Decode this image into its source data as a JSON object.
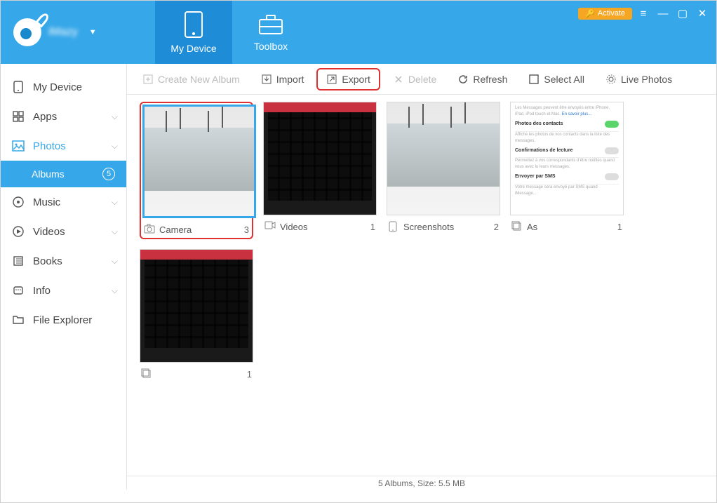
{
  "header": {
    "tabs": [
      {
        "label": "My Device",
        "active": true
      },
      {
        "label": "Toolbox",
        "active": false
      }
    ],
    "activate_label": "Activate"
  },
  "sidebar": {
    "items": [
      {
        "icon": "device",
        "label": "My Device",
        "expandable": false
      },
      {
        "icon": "apps",
        "label": "Apps",
        "expandable": true
      },
      {
        "icon": "photos",
        "label": "Photos",
        "expandable": true,
        "active": true,
        "sub": {
          "label": "Albums",
          "count": "5"
        }
      },
      {
        "icon": "music",
        "label": "Music",
        "expandable": true
      },
      {
        "icon": "videos",
        "label": "Videos",
        "expandable": true
      },
      {
        "icon": "books",
        "label": "Books",
        "expandable": true
      },
      {
        "icon": "info",
        "label": "Info",
        "expandable": true
      },
      {
        "icon": "folder",
        "label": "File Explorer",
        "expandable": false
      }
    ]
  },
  "toolbar": {
    "create_label": "Create New Album",
    "import_label": "Import",
    "export_label": "Export",
    "delete_label": "Delete",
    "refresh_label": "Refresh",
    "select_all_label": "Select All",
    "live_photos_label": "Live Photos"
  },
  "albums": [
    {
      "name": "Camera",
      "count": "3",
      "icon": "camera",
      "thumb": "house",
      "selected": true,
      "highlighted": true
    },
    {
      "name": "Videos",
      "count": "1",
      "icon": "video",
      "thumb": "keyboard-red"
    },
    {
      "name": "Screenshots",
      "count": "2",
      "icon": "screenshot",
      "thumb": "house"
    },
    {
      "name": "As",
      "count": "1",
      "icon": "album",
      "thumb": "settings"
    },
    {
      "name": "     ",
      "count": "1",
      "icon": "album",
      "thumb": "keyboard-red",
      "blurred": true
    }
  ],
  "statusbar": {
    "text": "5 Albums, Size: 5.5 MB"
  }
}
